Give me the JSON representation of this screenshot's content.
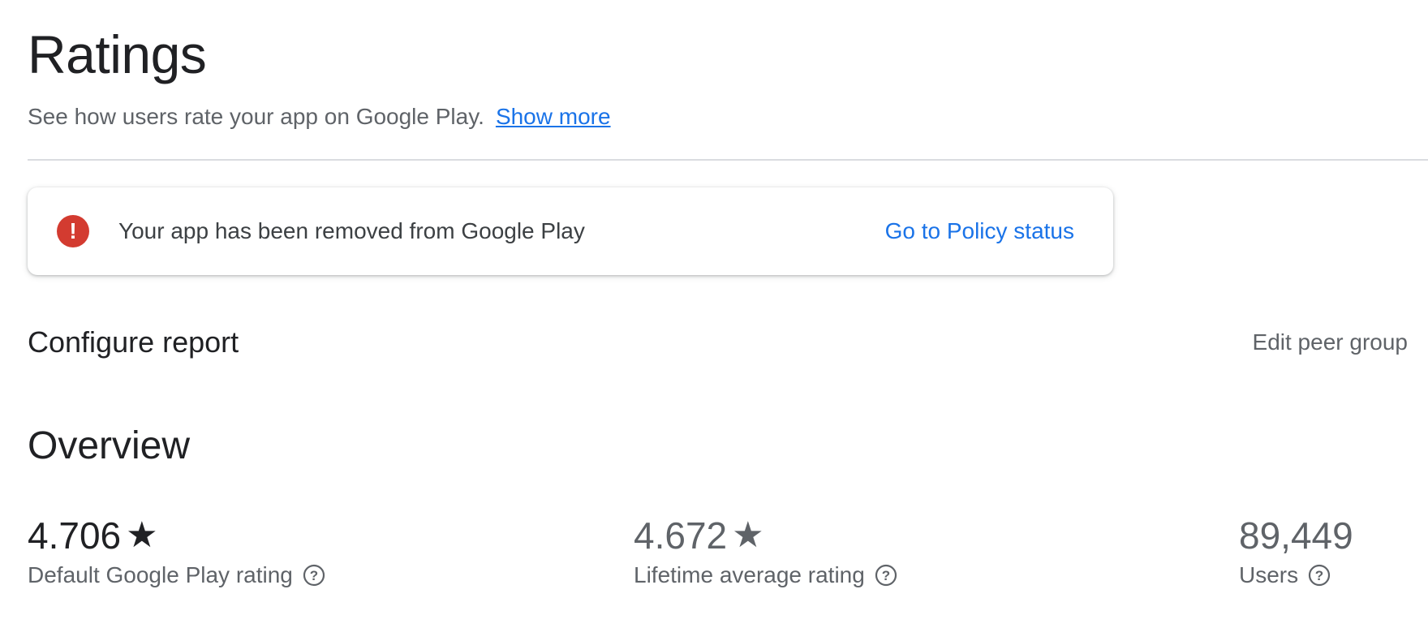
{
  "header": {
    "title": "Ratings",
    "subtitle": "See how users rate your app on Google Play.",
    "show_more_link": "Show more"
  },
  "alert": {
    "icon": "error-icon",
    "color": "#d33b30",
    "message": "Your app has been removed from Google Play",
    "action_link": "Go to Policy status"
  },
  "configure": {
    "heading": "Configure report",
    "edit_peer_group": "Edit peer group"
  },
  "overview": {
    "heading": "Overview",
    "metrics": [
      {
        "value": "4.706",
        "star": "★",
        "label": "Default Google Play rating",
        "help_icon": "help-icon"
      },
      {
        "value": "4.672",
        "star": "★",
        "label": "Lifetime average rating",
        "help_icon": "help-icon"
      },
      {
        "value": "89,449",
        "label": "Users",
        "help_icon": "help-icon"
      }
    ]
  },
  "colors": {
    "link": "#1a73e8",
    "text_primary": "#202124",
    "text_secondary": "#5f6368",
    "error": "#d33b30"
  }
}
